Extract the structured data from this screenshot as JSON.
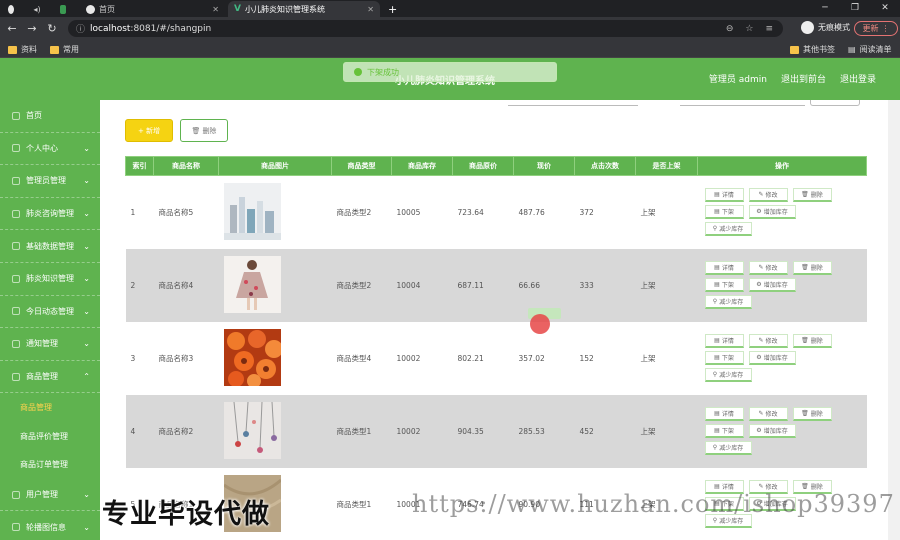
{
  "browser": {
    "tabs": [
      {
        "label": "首页"
      },
      {
        "label": "小儿肺炎知识管理系统"
      }
    ],
    "new_tab": "+",
    "url_host": "localhost",
    "url_rest": ":8081/#/shangpin",
    "incognito_label": "无痕模式",
    "update_label": "更新",
    "bookmarks": [
      "资料",
      "常用"
    ],
    "other_bookmarks": "其他书签",
    "reading_list": "阅读清单"
  },
  "app": {
    "title": "小儿肺炎知识管理系统",
    "toast": "下架成功",
    "header_links": {
      "admin": "管理员 admin",
      "back": "退出到前台",
      "logout": "退出登录"
    }
  },
  "sidebar": {
    "items": [
      {
        "label": "首页",
        "has_children": false
      },
      {
        "label": "个人中心",
        "has_children": true
      },
      {
        "label": "管理员管理",
        "has_children": true
      },
      {
        "label": "肺炎咨询管理",
        "has_children": true
      },
      {
        "label": "基础数据管理",
        "has_children": true
      },
      {
        "label": "肺炎知识管理",
        "has_children": true
      },
      {
        "label": "今日动态管理",
        "has_children": true
      },
      {
        "label": "通知管理",
        "has_children": true
      },
      {
        "label": "商品管理",
        "has_children": true,
        "expanded": true,
        "children": [
          "商品管理",
          "商品评价管理",
          "商品订单管理"
        ],
        "active_child": 0
      },
      {
        "label": "用户管理",
        "has_children": true
      },
      {
        "label": "轮播图信息",
        "has_children": true
      }
    ]
  },
  "toolbar": {
    "add_label": "+ 新增",
    "delete_label": "删除"
  },
  "table": {
    "columns": [
      "索引",
      "商品名称",
      "商品图片",
      "商品类型",
      "商品库存",
      "商品原价",
      "现价",
      "点击次数",
      "是否上架",
      "操作"
    ],
    "actions": {
      "detail": "详情",
      "edit": "修改",
      "delete": "删除",
      "offshelf": "下架",
      "add_stock": "增加库存",
      "reduce_stock": "减少库存"
    },
    "rows": [
      {
        "index": "1",
        "name": "商品名称5",
        "image": "cosmetics-bottles-photo",
        "type": "商品类型2",
        "stock": "10005",
        "orig_price": "723.64",
        "price": "487.76",
        "clicks": "372",
        "status": "上架"
      },
      {
        "index": "2",
        "name": "商品名称4",
        "image": "floral-dress-model-photo",
        "type": "商品类型2",
        "stock": "10004",
        "orig_price": "687.11",
        "price": "66.66",
        "clicks": "333",
        "status": "上架"
      },
      {
        "index": "3",
        "name": "商品名称3",
        "image": "orange-flowers-photo",
        "type": "商品类型4",
        "stock": "10002",
        "orig_price": "802.21",
        "price": "357.02",
        "clicks": "152",
        "status": "上架"
      },
      {
        "index": "4",
        "name": "商品名称2",
        "image": "hanging-jewelry-photo",
        "type": "商品类型1",
        "stock": "10002",
        "orig_price": "904.35",
        "price": "285.53",
        "clicks": "452",
        "status": "上架"
      },
      {
        "index": "5",
        "name": "商品名称1",
        "image": "beige-fabric-photo",
        "type": "商品类型1",
        "stock": "10001",
        "orig_price": "746.74",
        "price": "90.90",
        "clicks": "111",
        "status": "上架"
      }
    ]
  },
  "overlay": {
    "watermark_cn": "专业毕设代做",
    "watermark_url": "https://www.huzhan.com/ishop39397"
  }
}
